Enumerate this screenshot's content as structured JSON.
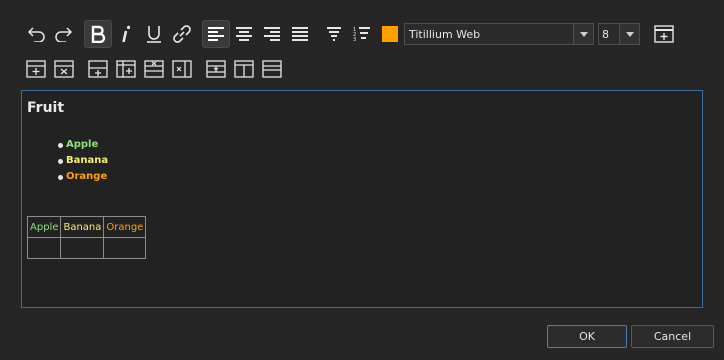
{
  "toolbar": {
    "font_family": "Titillium Web",
    "font_size": "8",
    "text_color": "#ff9f00",
    "icons": [
      "undo-icon",
      "redo-icon",
      "bold-icon",
      "italic-icon",
      "underline-icon",
      "link-icon",
      "align-left-icon",
      "align-center-icon",
      "align-right-icon",
      "align-justify-icon",
      "bullet-list-icon",
      "numbered-list-icon",
      "insert-table-icon"
    ]
  },
  "table_toolbar": {
    "icons": [
      "insert-row-above-icon",
      "delete-row-icon",
      "insert-row-below-icon",
      "insert-column-icon",
      "delete-column-icon",
      "delete-cell-icon",
      "merge-cells-icon",
      "split-column-icon",
      "split-row-icon"
    ]
  },
  "document": {
    "heading": "Fruit",
    "list": [
      {
        "text": "Apple",
        "color": "#8fe07a"
      },
      {
        "text": "Banana",
        "color": "#f3ef7a"
      },
      {
        "text": "Orange",
        "color": "#ffa21a"
      }
    ],
    "table": {
      "header": [
        {
          "text": "Apple",
          "color": "#8fe07a"
        },
        {
          "text": "Banana",
          "color": "#f3ef7a"
        },
        {
          "text": "Orange",
          "color": "#ffa21a"
        }
      ],
      "rows": [
        [
          "",
          "",
          ""
        ]
      ]
    }
  },
  "buttons": {
    "ok": "OK",
    "cancel": "Cancel"
  }
}
